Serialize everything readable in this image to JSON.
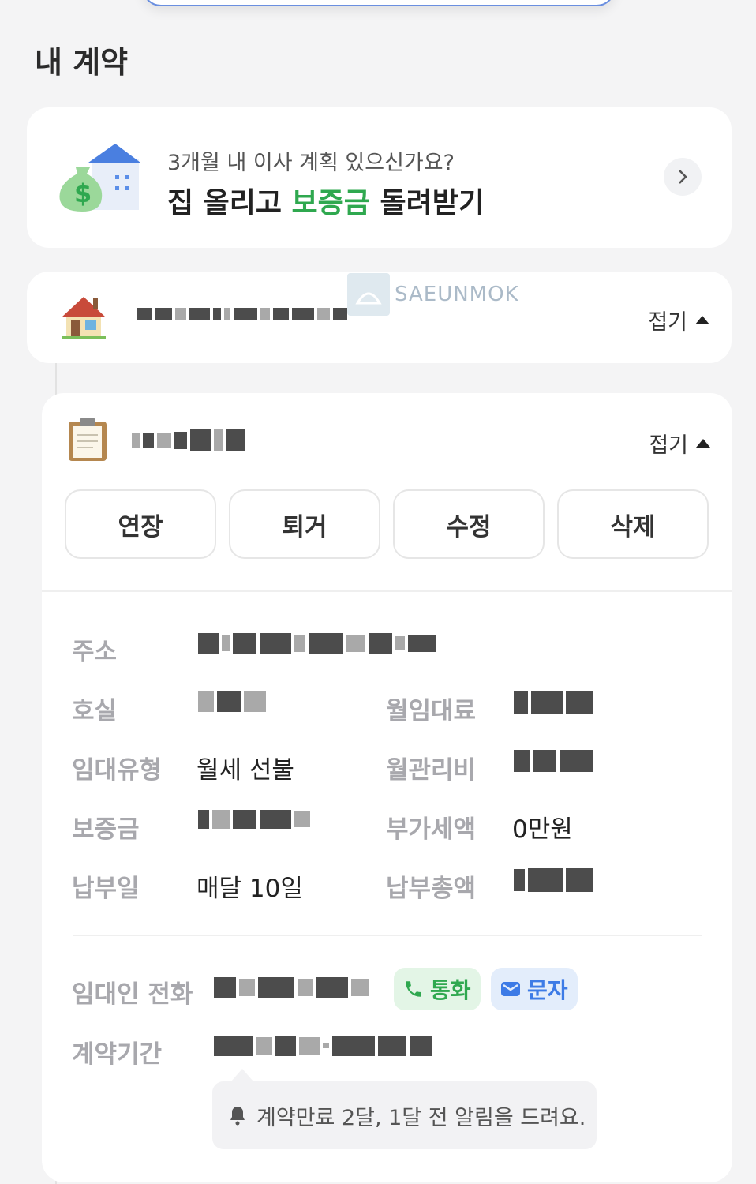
{
  "section": {
    "title": "내 계약"
  },
  "promo": {
    "subtitle": "3개월 내 이사 계획 있으신가요?",
    "title_pre": "집 올리고 ",
    "title_highlight": "보증금",
    "title_post": " 돌려받기",
    "highlight_color": "#2fa84f"
  },
  "watermark": {
    "text": "SAEUNMOK"
  },
  "house": {
    "fold_label": "접기"
  },
  "contract": {
    "fold_label": "접기",
    "actions": [
      "연장",
      "퇴거",
      "수정",
      "삭제"
    ],
    "labels": {
      "address": "주소",
      "unit": "호실",
      "rent": "월임대료",
      "lease_type": "임대유형",
      "mgmt_fee": "월관리비",
      "deposit": "보증금",
      "vat": "부가세액",
      "pay_day": "납부일",
      "total": "납부총액",
      "landlord_phone": "임대인 전화",
      "period": "계약기간"
    },
    "values": {
      "lease_type": "월세 선불",
      "vat": "0만원",
      "pay_day": "매달 10일"
    },
    "call_label": "통화",
    "sms_label": "문자",
    "reminder": "계약만료 2달, 1달 전 알림을 드려요."
  },
  "icons": [
    "money-house-icon",
    "chevron-right-icon",
    "house-icon",
    "clipboard-icon",
    "caret-up-icon",
    "phone-icon",
    "mail-icon",
    "bell-icon"
  ]
}
